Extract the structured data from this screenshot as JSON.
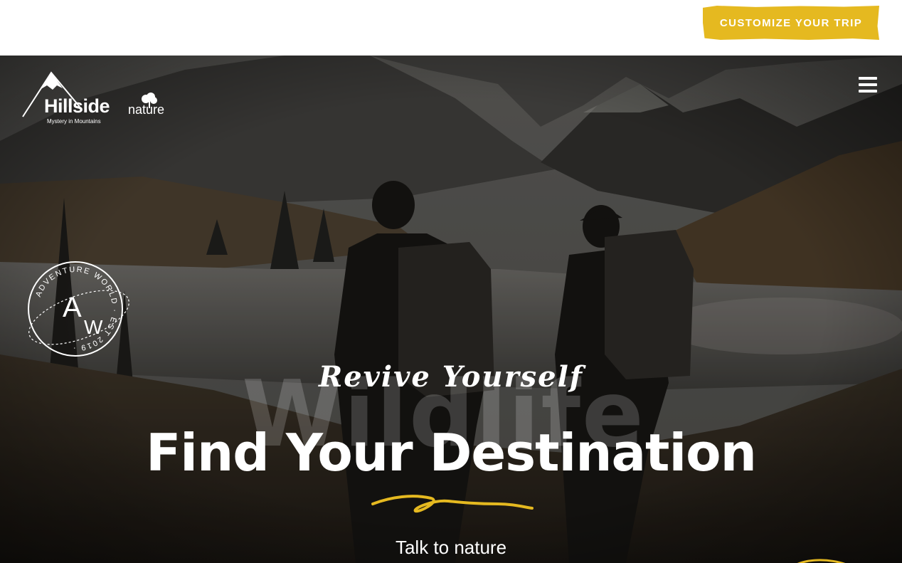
{
  "header": {
    "cta_label": "CUSTOMIZE YOUR TRIP"
  },
  "logo": {
    "brand": "Hillside",
    "brand_sub": "nature",
    "tagline": "Mystery in Mountains"
  },
  "badge": {
    "ring_text": "ADVENTURE WORLD · EST 2019 ·",
    "monogram_a": "A",
    "monogram_w": "W"
  },
  "hero": {
    "background_word": "Wildlife",
    "script_title": "Revive Yourself",
    "headline": "Find Your Destination",
    "subtitle": "Talk to nature"
  },
  "icons": {
    "menu": "hamburger-menu-icon",
    "logo_mountain": "mountain-icon",
    "logo_tree": "tree-icon"
  },
  "colors": {
    "accent": "#e5b920",
    "text_light": "#ffffff",
    "overlay": "#3a3a38"
  }
}
